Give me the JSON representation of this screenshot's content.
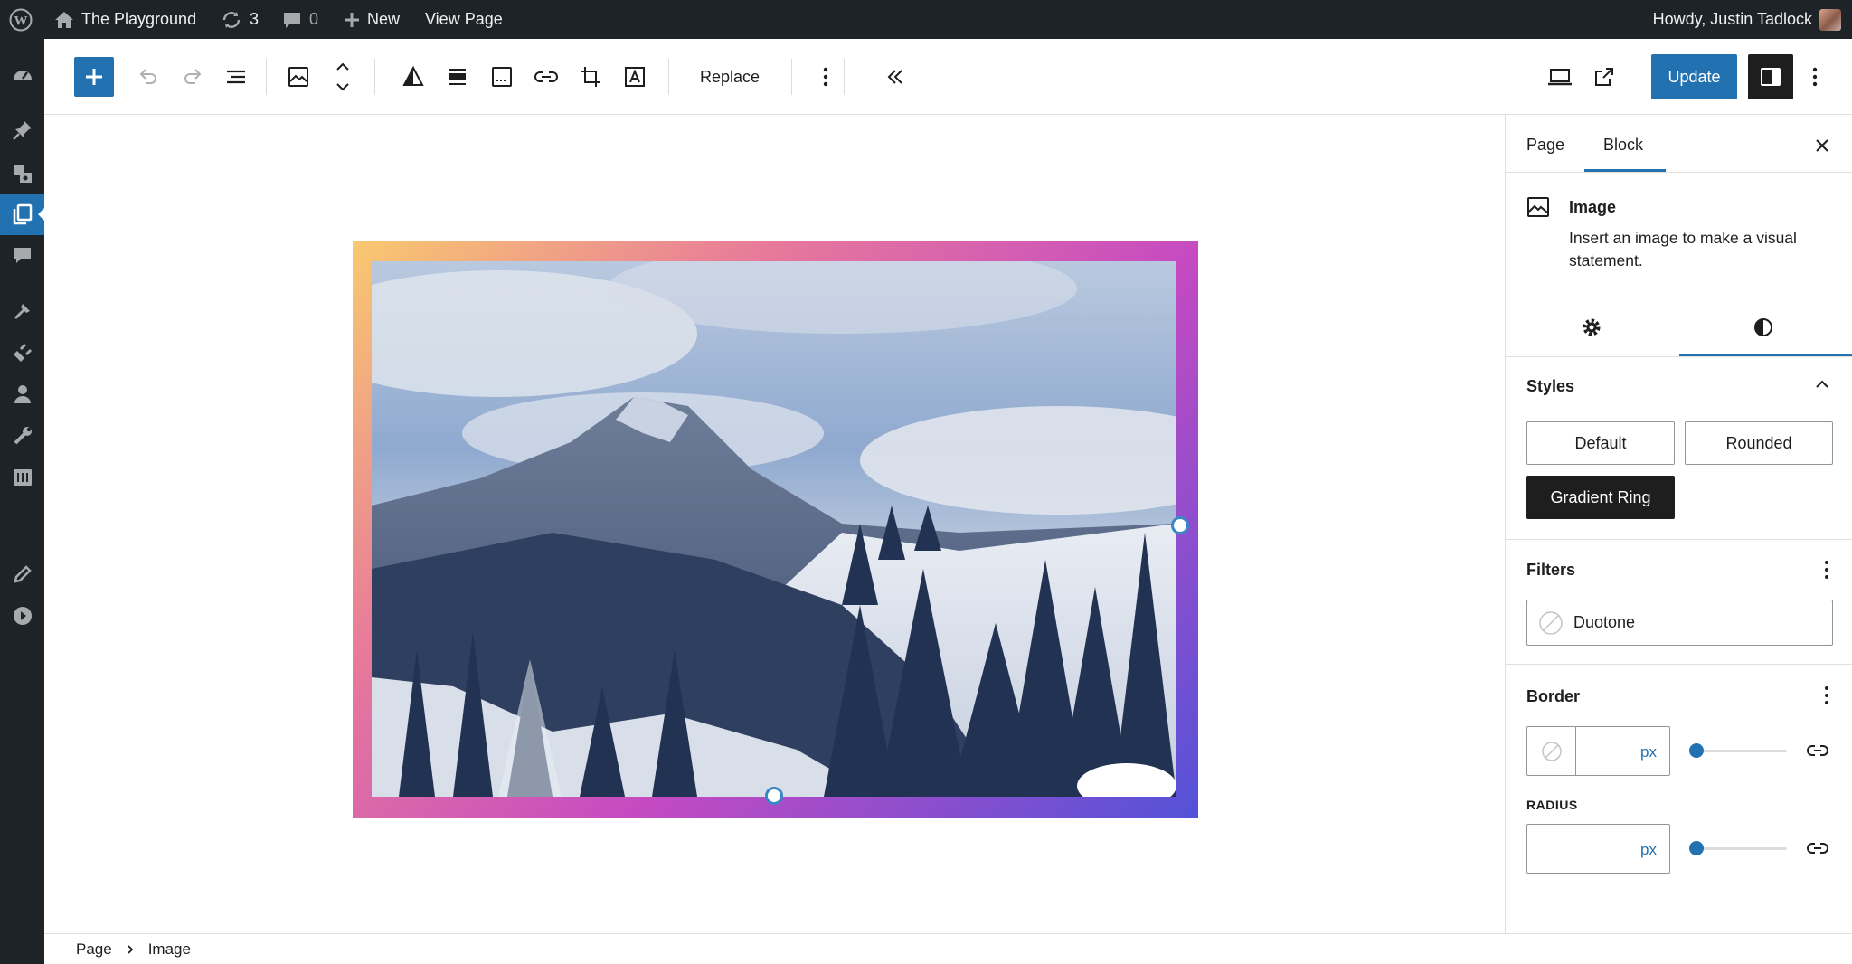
{
  "admin_bar": {
    "site_name": "The Playground",
    "updates_count": "3",
    "comments_count": "0",
    "new_label": "New",
    "view_page_label": "View Page",
    "greeting": "Howdy, Justin Tadlock"
  },
  "toolbar": {
    "replace_label": "Replace",
    "update_label": "Update"
  },
  "sidebar": {
    "tabs": [
      "Page",
      "Block"
    ],
    "active_tab": "Block",
    "block_card": {
      "title": "Image",
      "description": "Insert an image to make a visual statement."
    },
    "styles": {
      "title": "Styles",
      "options": [
        "Default",
        "Rounded",
        "Gradient Ring"
      ],
      "active": "Gradient Ring"
    },
    "filters": {
      "title": "Filters",
      "duotone_label": "Duotone"
    },
    "border": {
      "title": "Border",
      "width_unit": "px",
      "radius_label": "RADIUS",
      "radius_unit": "px"
    }
  },
  "breadcrumb": [
    "Page",
    "Image"
  ],
  "icons": [
    "wordpress-icon",
    "home-icon",
    "updates-icon",
    "comment-icon",
    "plus-icon",
    "dashboard-icon",
    "pin-icon",
    "media-icon",
    "pages-icon",
    "comments-icon",
    "appearance-icon",
    "plugins-icon",
    "users-icon",
    "tools-icon",
    "settings-icon",
    "edit-icon",
    "play-icon",
    "undo-icon",
    "redo-icon",
    "list-view-icon",
    "image-icon",
    "move-icon",
    "duotone-icon",
    "align-icon",
    "caption-icon",
    "link-icon",
    "crop-icon",
    "text-overlay-icon",
    "more-icon",
    "collapse-icon",
    "desktop-preview-icon",
    "external-icon",
    "sidebar-icon",
    "close-icon",
    "gear-icon",
    "contrast-icon",
    "chevron-up-icon",
    "unlink-icon"
  ],
  "colors": {
    "admin_dark": "#1d2327",
    "accent": "#2271b1",
    "gradient": [
      "#f9c96f",
      "#e7799b",
      "#c54ac2",
      "#5352d8"
    ]
  }
}
